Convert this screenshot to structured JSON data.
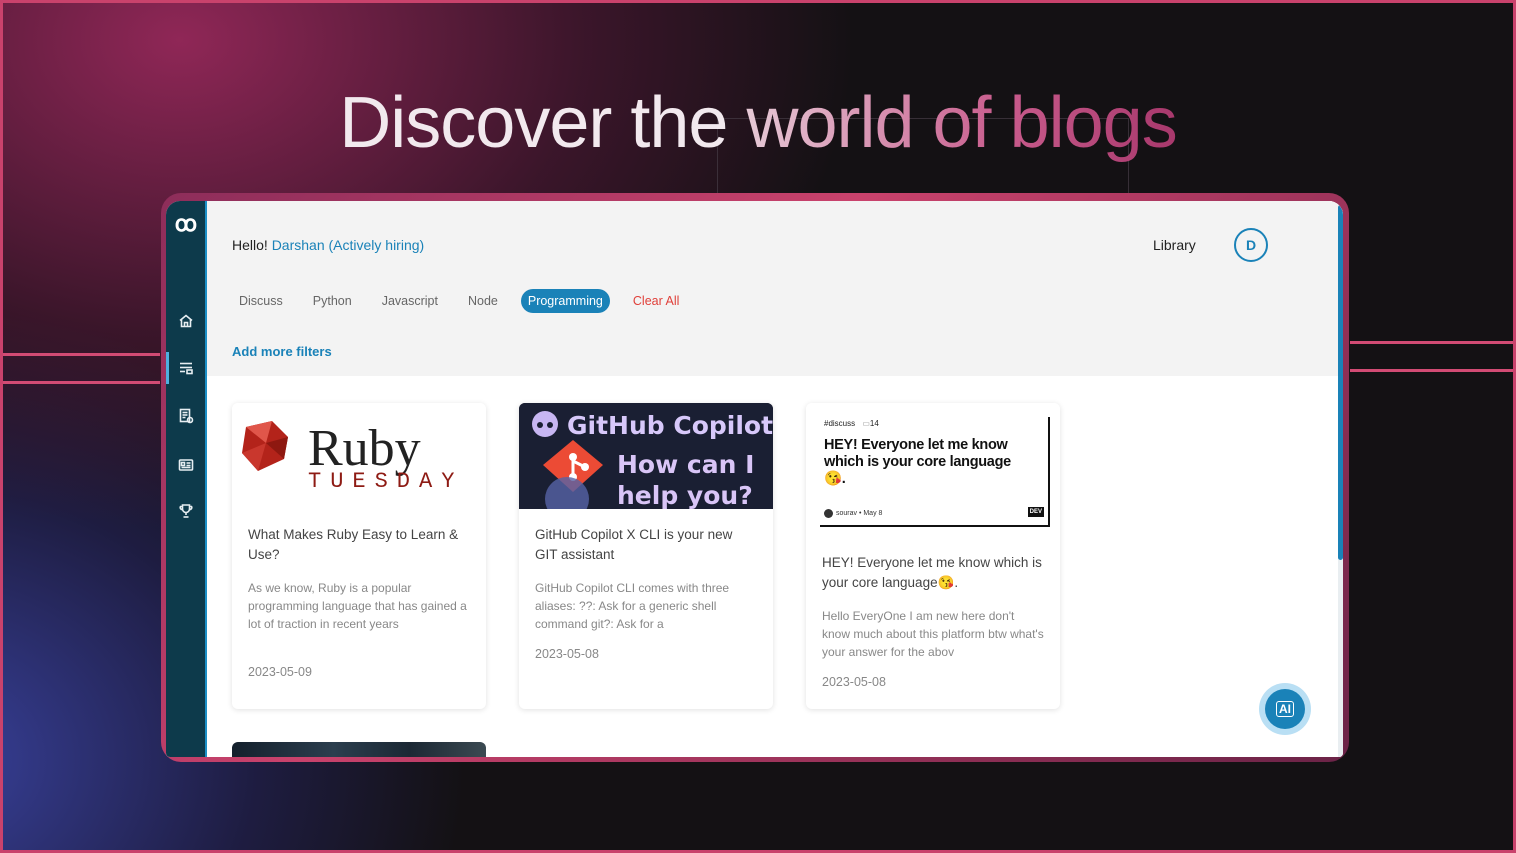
{
  "headline": {
    "part1": "Discover the ",
    "part2": "world of blogs"
  },
  "header": {
    "greeting_prefix": "Hello!",
    "user_name": "Darshan (Actively hiring)",
    "library_label": "Library",
    "avatar_initial": "D"
  },
  "filters": {
    "items": [
      "Discuss",
      "Python",
      "Javascript",
      "Node",
      "Programming"
    ],
    "active": "Programming",
    "clear_label": "Clear All",
    "add_more_label": "Add more filters"
  },
  "sidebar": {
    "logo": "ꝏ",
    "icons": [
      "home-icon",
      "feed-icon",
      "articles-icon",
      "profile-card-icon",
      "trophy-icon"
    ],
    "active": "feed-icon"
  },
  "cards": [
    {
      "image": {
        "brand": "Ruby",
        "sub": "TUESDAY"
      },
      "title": "What Makes Ruby Easy to Learn & Use?",
      "desc": "As we know, Ruby is a popular programming language that has gained a lot of traction in recent years",
      "date": "2023-05-09"
    },
    {
      "image": {
        "brand": "GitHub Copilot",
        "line1": "How can I",
        "line2": "help you?"
      },
      "title": "GitHub Copilot X CLI is your new GIT assistant",
      "desc": "GitHub Copilot CLI comes with three aliases: ??: Ask for a generic shell command git?: Ask for a",
      "date": "2023-05-08"
    },
    {
      "image": {
        "tag": "#discuss",
        "comments": "14",
        "heading": "HEY! Everyone let me know which is your core language",
        "emoji": "😘.",
        "author": "sourav • May 8",
        "badge": "DEV"
      },
      "title": "HEY! Everyone let me know which is your core language😘.",
      "desc": "Hello EveryOne I am new here don't know much about this platform btw what's your answer for the abov",
      "date": "2023-05-08"
    }
  ],
  "ai_button": {
    "label": "AI"
  },
  "colors": {
    "accent": "#1a82b8",
    "sidebar": "#0d3a4b",
    "frame": "#c9426c",
    "clear": "#e0403a"
  }
}
